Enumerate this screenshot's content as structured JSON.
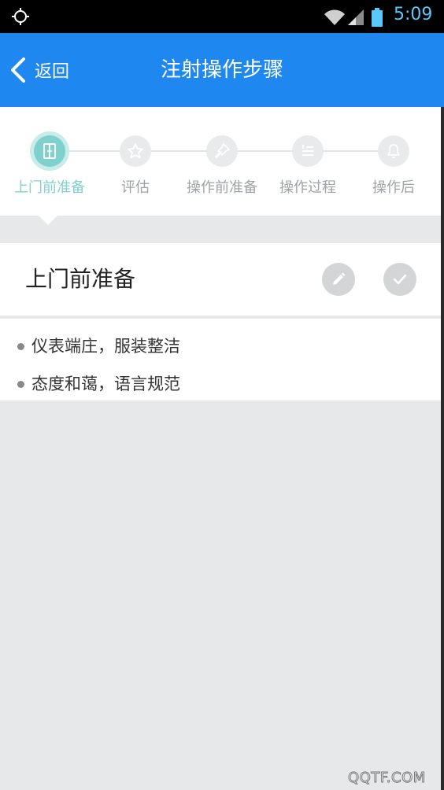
{
  "status_bar": {
    "time": "5:09",
    "icons": [
      "gps-icon",
      "wifi-icon",
      "signal-icon",
      "battery-icon"
    ]
  },
  "header": {
    "back_label": "返回",
    "title": "注射操作步骤",
    "color": "#1e88f0"
  },
  "stepper": {
    "active_index": 0,
    "active_color": "#7fd1cc",
    "steps": [
      {
        "label": "上门前准备",
        "icon": "door-icon"
      },
      {
        "label": "评估",
        "icon": "star-icon"
      },
      {
        "label": "操作前准备",
        "icon": "pin-icon"
      },
      {
        "label": "操作过程",
        "icon": "list-icon"
      },
      {
        "label": "操作后",
        "icon": "bell-icon"
      }
    ]
  },
  "section": {
    "title": "上门前准备",
    "actions": [
      "edit-icon",
      "check-icon"
    ]
  },
  "checklist": {
    "items": [
      "仪表端庄，服装整洁",
      "态度和蔼，语言规范"
    ]
  },
  "watermark": "QQTF.COM"
}
